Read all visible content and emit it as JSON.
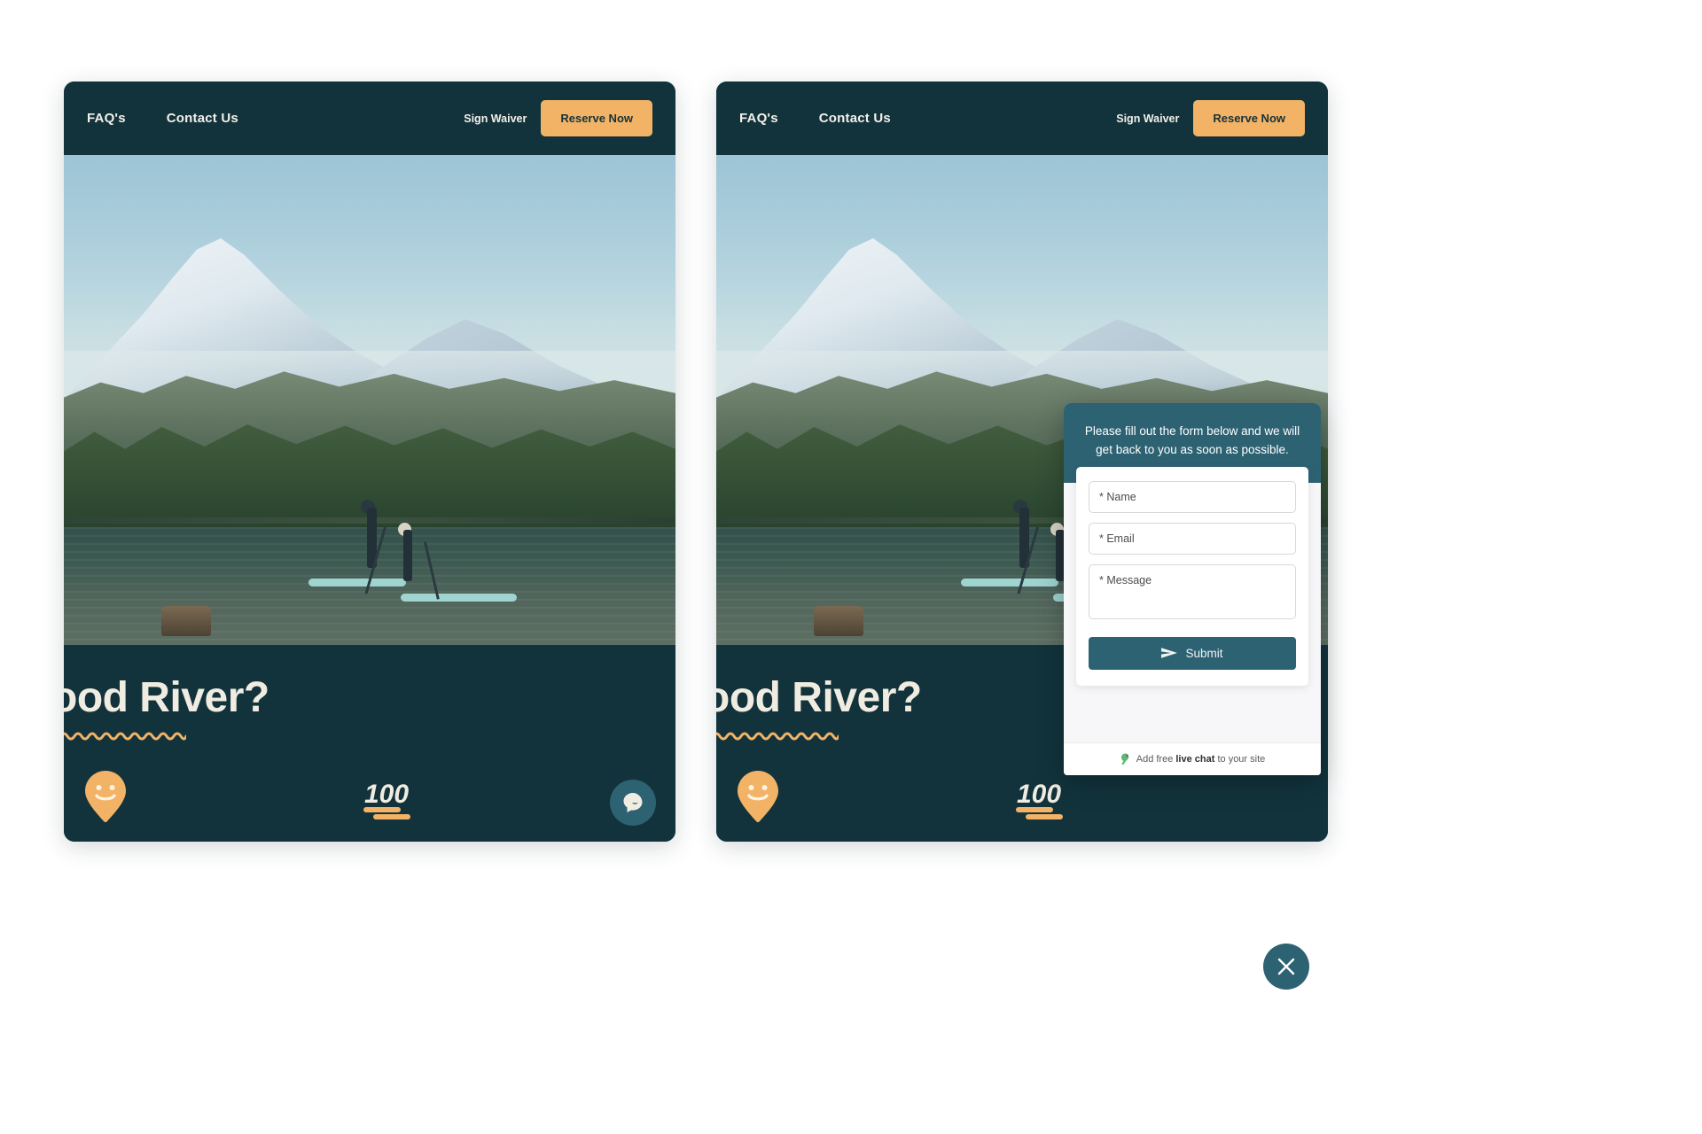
{
  "nav": {
    "links": [
      {
        "label": "FAQ's",
        "name": "nav-link-faqs"
      },
      {
        "label": "Contact Us",
        "name": "nav-link-contact-us"
      }
    ],
    "sign_waiver": "Sign Waiver",
    "reserve_button": "Reserve Now"
  },
  "hero": {
    "alt": "paddle-boarders-on-lake-with-snowy-mountain"
  },
  "bottom": {
    "headline": "ood River?",
    "emoji_100": "100",
    "pin_icon": "smiley-map-pin-icon",
    "wave_icon": "wavy-underline"
  },
  "launcher": {
    "open_icon": "chat-bubble-icon",
    "close_icon": "close-icon"
  },
  "chat": {
    "header_text": "Please fill out the form below and we will get back to you as soon as possible.",
    "fields": {
      "name_placeholder": "* Name",
      "email_placeholder": "* Email",
      "message_placeholder": "* Message"
    },
    "submit_label": "Submit",
    "submit_icon": "send-icon",
    "footer": {
      "icon": "parrot-icon",
      "prefix": "Add free ",
      "strong": "live chat",
      "suffix": " to your site"
    }
  },
  "colors": {
    "dark_teal": "#12333c",
    "accent_orange": "#f2b366",
    "chat_teal": "#2d6273",
    "cream": "#f0ece1"
  }
}
